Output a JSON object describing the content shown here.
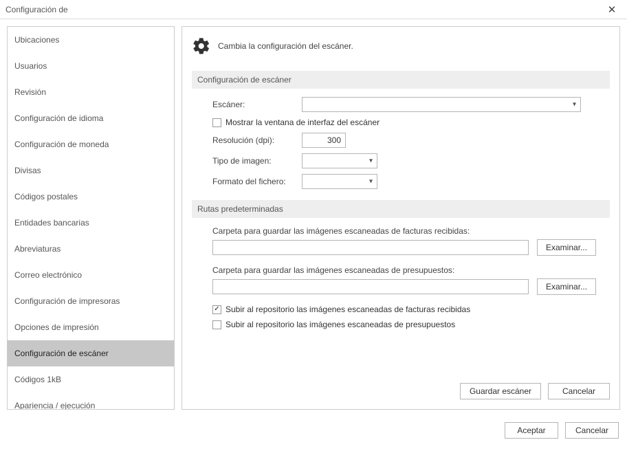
{
  "window": {
    "title": "Configuración de"
  },
  "sidebar": {
    "items": [
      {
        "label": "Ubicaciones"
      },
      {
        "label": "Usuarios"
      },
      {
        "label": "Revisión"
      },
      {
        "label": "Configuración de idioma"
      },
      {
        "label": "Configuración de moneda"
      },
      {
        "label": "Divisas"
      },
      {
        "label": "Códigos postales"
      },
      {
        "label": "Entidades bancarias"
      },
      {
        "label": "Abreviaturas"
      },
      {
        "label": "Correo electrónico"
      },
      {
        "label": "Configuración de impresoras"
      },
      {
        "label": "Opciones de impresión"
      },
      {
        "label": "Configuración de escáner"
      },
      {
        "label": "Códigos 1kB"
      },
      {
        "label": "Apariencia / ejecución"
      }
    ],
    "selectedIndex": 12
  },
  "main": {
    "subtitle": "Cambia la configuración del escáner.",
    "scanner_section": "Configuración de escáner",
    "labels": {
      "scanner": "Escáner:",
      "show_ui": "Mostrar la ventana de interfaz del escáner",
      "resolution": "Resolución (dpi):",
      "image_type": "Tipo de imagen:",
      "file_format": "Formato del fichero:"
    },
    "values": {
      "scanner": "",
      "show_ui_checked": false,
      "resolution": "300",
      "image_type": "",
      "file_format": ""
    },
    "paths_section": "Rutas predeterminadas",
    "paths": {
      "invoices_label": "Carpeta para guardar las imágenes escaneadas de facturas recibidas:",
      "invoices_value": "",
      "quotes_label": "Carpeta para guardar las imágenes escaneadas de presupuestos:",
      "quotes_value": "",
      "browse": "Examinar..."
    },
    "upload": {
      "invoices_label": "Subir al repositorio las imágenes escaneadas de facturas recibidas",
      "invoices_checked": true,
      "quotes_label": "Subir al repositorio las imágenes escaneadas de presupuestos",
      "quotes_checked": false
    },
    "buttons": {
      "save": "Guardar escáner",
      "cancel": "Cancelar"
    }
  },
  "footer": {
    "ok": "Aceptar",
    "cancel": "Cancelar"
  }
}
